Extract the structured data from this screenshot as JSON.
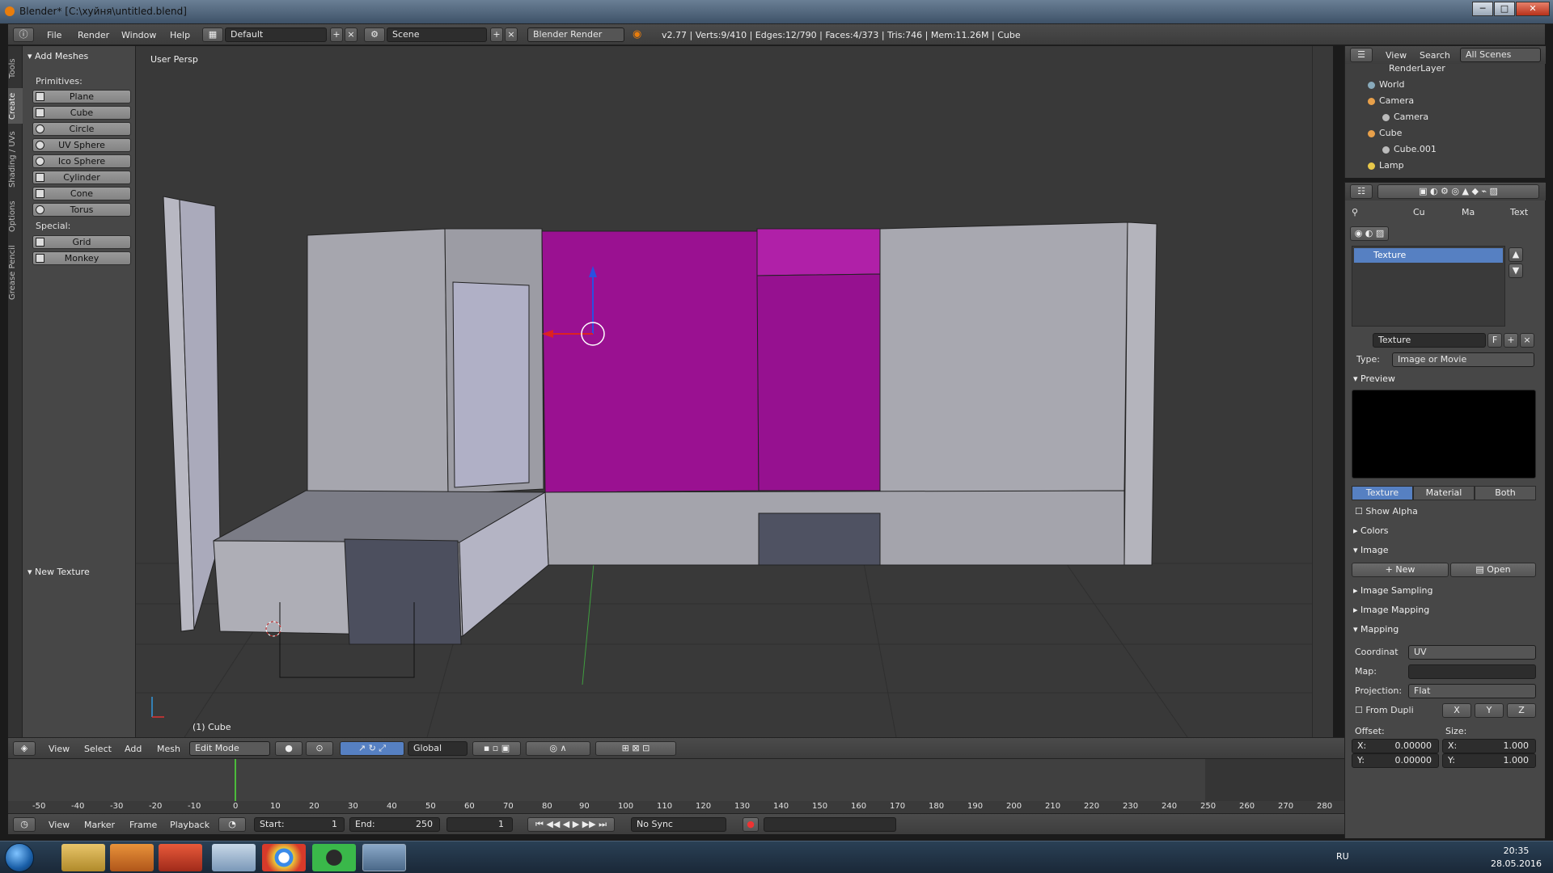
{
  "window": {
    "title": "Blender* [C:\\хуйня\\untitled.blend]",
    "minimize": "─",
    "maximize": "□",
    "close": "✕"
  },
  "infobar": {
    "menus": [
      "File",
      "Render",
      "Window",
      "Help"
    ],
    "layout": "Default",
    "scene": "Scene",
    "engine": "Blender Render",
    "stats": "v2.77 | Verts:9/410 | Edges:12/790 | Faces:4/373 | Tris:746 | Mem:11.26M | Cube"
  },
  "left_tabs": [
    "Tools",
    "Create",
    "Shading / UVs",
    "Options",
    "Grease Pencil"
  ],
  "toolshelf": {
    "add_meshes": "Add Meshes",
    "primitives_label": "Primitives:",
    "primitives": [
      "Plane",
      "Cube",
      "Circle",
      "UV Sphere",
      "Ico Sphere",
      "Cylinder",
      "Cone",
      "Torus"
    ],
    "special_label": "Special:",
    "special": [
      "Grid",
      "Monkey"
    ],
    "new_texture": "New Texture"
  },
  "viewport": {
    "view_label": "User Persp",
    "object_label": "(1) Cube"
  },
  "view3d_header": {
    "menus": [
      "View",
      "Select",
      "Add",
      "Mesh"
    ],
    "mode": "Edit Mode",
    "orientation": "Global"
  },
  "timeline": {
    "ticks": [
      "-50",
      "-40",
      "-30",
      "-20",
      "-10",
      "0",
      "10",
      "20",
      "30",
      "40",
      "50",
      "60",
      "70",
      "80",
      "90",
      "100",
      "110",
      "120",
      "130",
      "140",
      "150",
      "160",
      "170",
      "180",
      "190",
      "200",
      "210",
      "220",
      "230",
      "240",
      "250",
      "260",
      "270",
      "280"
    ],
    "menus": [
      "View",
      "Marker",
      "Frame",
      "Playback"
    ],
    "start_label": "Start:",
    "start": "1",
    "end_label": "End:",
    "end": "250",
    "current": "1",
    "sync": "No Sync"
  },
  "outliner": {
    "menus": [
      "View",
      "Search"
    ],
    "filter": "All Scenes",
    "rows": [
      "RenderLayer",
      "World",
      "Camera",
      "Camera",
      "Cube",
      "Cube.001",
      "Lamp"
    ]
  },
  "properties": {
    "breadcrumb": [
      "Cu",
      "Ma",
      "Text"
    ],
    "texture_slot": "Texture",
    "texture_name": "Texture",
    "fake_user": "F",
    "type_label": "Type:",
    "type_value": "Image or Movie",
    "preview_label": "Preview",
    "preview_tabs": [
      "Texture",
      "Material",
      "Both"
    ],
    "show_alpha": "Show Alpha",
    "colors": "Colors",
    "image": "Image",
    "new_label": "New",
    "open_label": "Open",
    "image_sampling": "Image Sampling",
    "image_mapping": "Image Mapping",
    "mapping": "Mapping",
    "coordinate_label": "Coordinat",
    "coordinate_value": "UV",
    "map_label": "Map:",
    "projection_label": "Projection:",
    "projection_value": "Flat",
    "from_dupli": "From Dupli",
    "axes": [
      "X",
      "Y",
      "Z"
    ],
    "offset_label": "Offset:",
    "size_label": "Size:",
    "offset_x": "X:",
    "offset_x_val": "0.00000",
    "offset_y": "Y:",
    "offset_y_val": "0.00000",
    "size_x": "X:",
    "size_x_val": "1.000",
    "size_y": "Y:",
    "size_y_val": "1.000"
  },
  "taskbar": {
    "lang": "RU",
    "time": "20:35",
    "date": "28.05.2016"
  },
  "colors": {
    "selected_face": "#9a1191",
    "mesh_face": "#a9a9b3",
    "accent_blue": "#5680c2"
  }
}
